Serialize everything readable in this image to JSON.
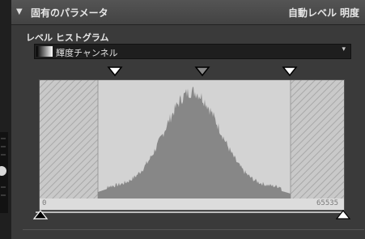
{
  "panel": {
    "title": "固有のパラメータ",
    "auto_level_label": "自動レベル",
    "brightness_label": "明度",
    "collapse_icon": "collapse-triangle-icon"
  },
  "levels": {
    "section_label": "レベル ヒストグラム",
    "channel_dropdown": {
      "selected": "輝度チャンネル",
      "swatch_icon": "gradient-swatch-icon"
    }
  },
  "histogram": {
    "axis_min_label": "0",
    "axis_max_label": "65535",
    "colors": {
      "background": "#1a1a1a",
      "active_area": "#d3d3d3",
      "histogram_fill": "#878787",
      "hatched_area": "#c9c9c9"
    },
    "input_black_point": 0.19,
    "input_gamma_point": 0.53,
    "input_white_point": 0.86,
    "output_black": 0,
    "output_white": 1
  }
}
